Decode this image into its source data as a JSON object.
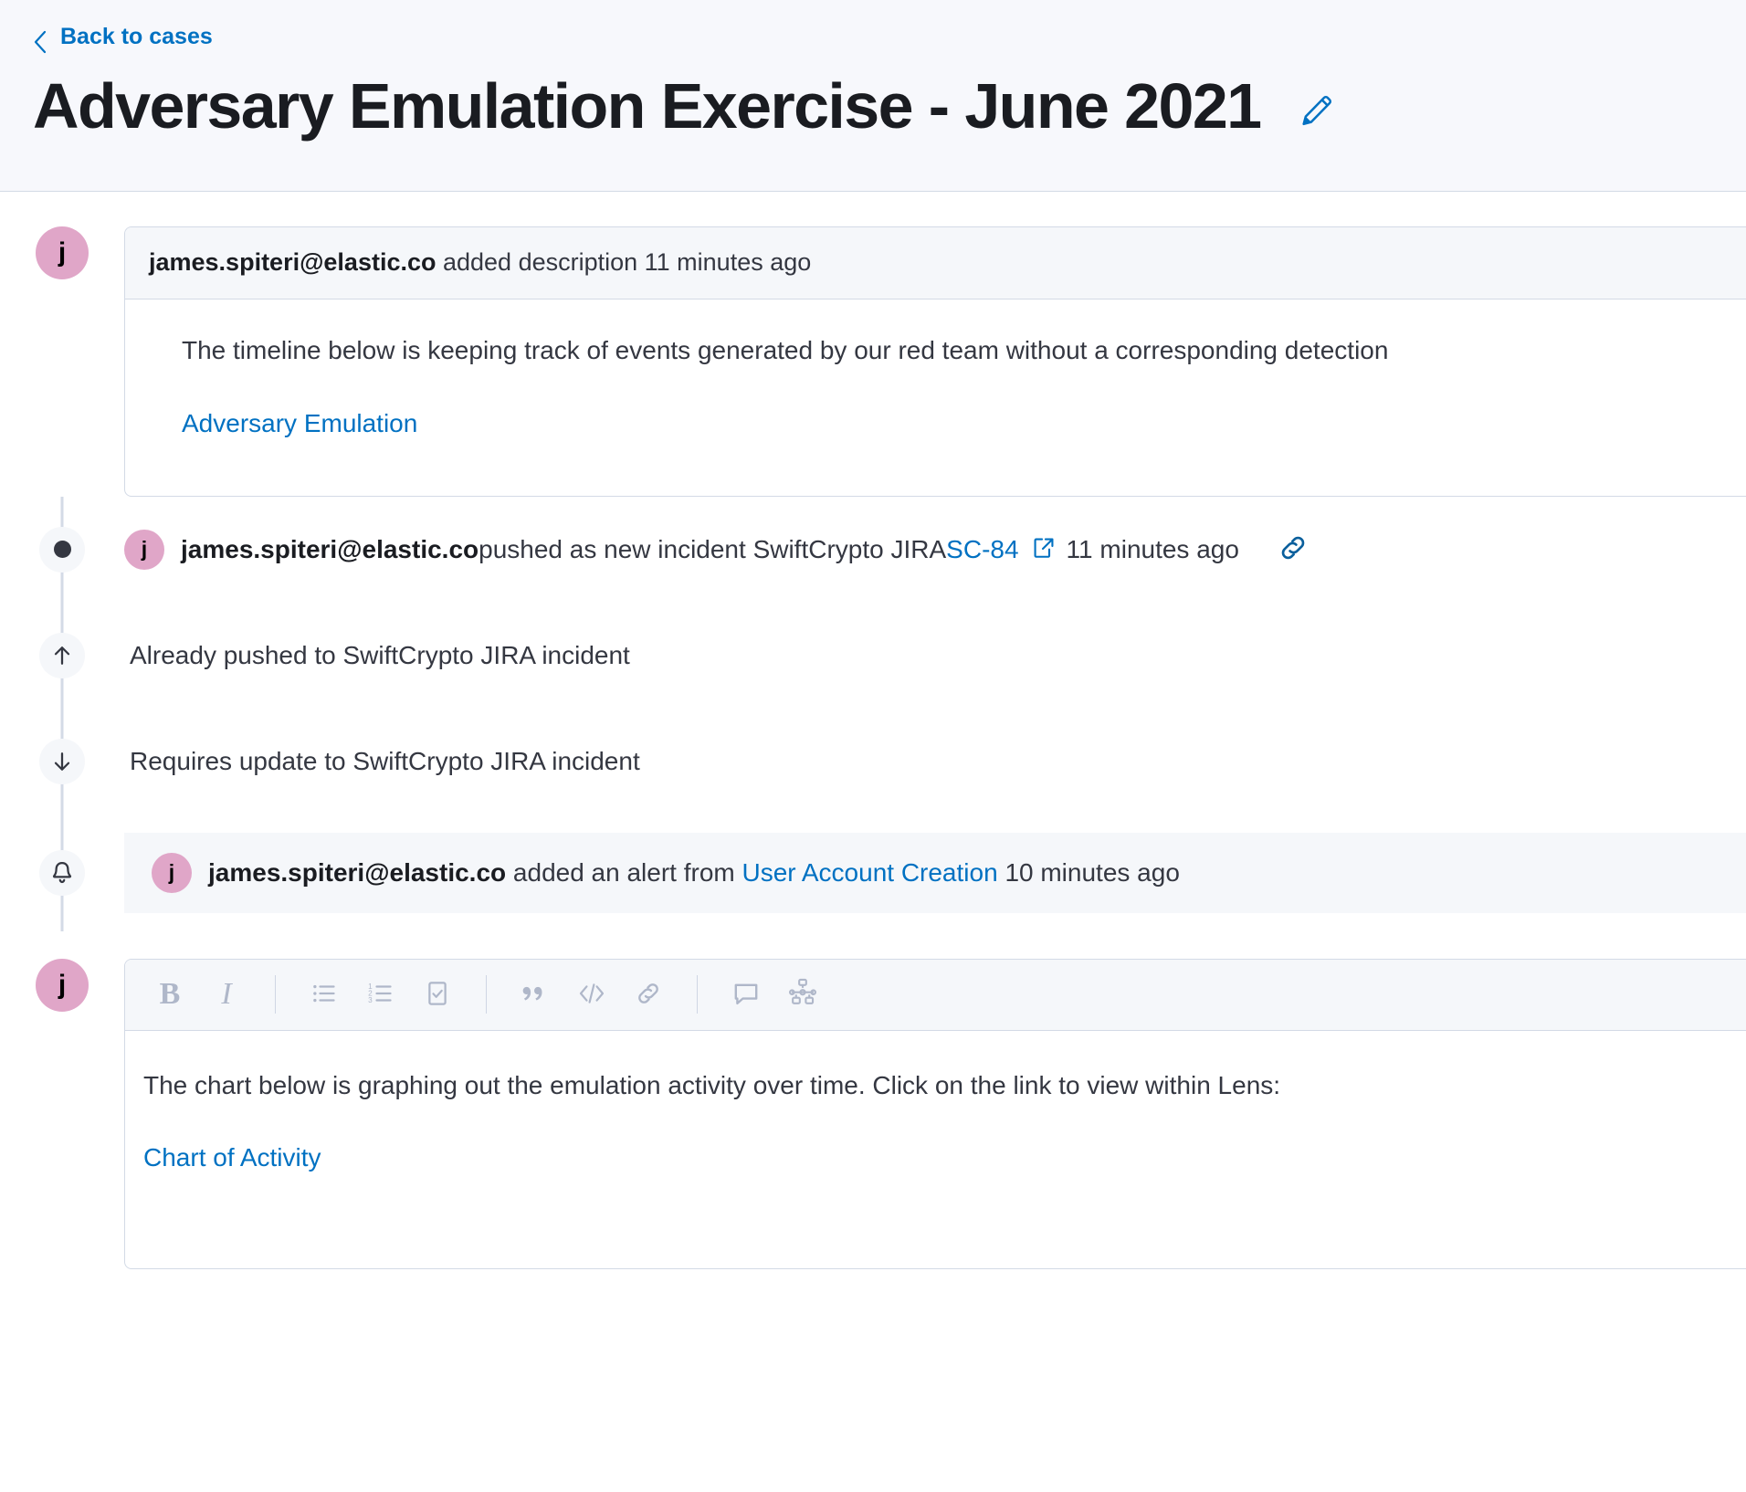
{
  "header": {
    "back_label": "Back to cases",
    "back_icon": "chevron-left-icon",
    "title": "Adversary Emulation Exercise - June 2021",
    "edit_icon": "pencil-edit-icon"
  },
  "colors": {
    "link": "#0071c2",
    "avatar_bg": "#e0a6c8",
    "panel_header_bg": "#f5f7fa",
    "border": "#d3dae6",
    "text": "#343741",
    "toolbar_icon": "#afb7c9"
  },
  "timeline": {
    "description_event": {
      "avatar_initial": "j",
      "user": "james.spiteri@elastic.co",
      "action": " added description ",
      "timestamp": "11 minutes ago",
      "body_text": "The timeline below is keeping track of events generated by our red team without a corresponding detection",
      "body_link": "Adversary Emulation"
    },
    "push_event": {
      "icon": "dot-icon",
      "avatar_initial": "j",
      "user": "james.spiteri@elastic.co",
      "action": " pushed as new incident SwiftCrypto JIRA ",
      "issue_link": "SC-84",
      "external_link_icon": "external-link-icon",
      "timestamp": "11 minutes ago",
      "copy_link_icon": "link-chain-icon"
    },
    "already_pushed_event": {
      "icon": "arrow-up-icon",
      "text": "Already pushed to SwiftCrypto JIRA incident"
    },
    "requires_update_event": {
      "icon": "arrow-down-icon",
      "text": "Requires update to SwiftCrypto JIRA incident"
    },
    "alert_event": {
      "icon": "bell-icon",
      "avatar_initial": "j",
      "user": "james.spiteri@elastic.co",
      "action": " added an alert from ",
      "rule_link": "User Account Creation",
      "timestamp": "10 minutes ago"
    },
    "comment_editor": {
      "avatar_initial": "j",
      "toolbar": [
        {
          "name": "bold-button",
          "label": "B",
          "kind": "text"
        },
        {
          "name": "italic-button",
          "label": "I",
          "kind": "text"
        },
        {
          "name": "separator-1",
          "kind": "sep"
        },
        {
          "name": "unordered-list-button",
          "kind": "icon",
          "icon": "bullet-list-icon"
        },
        {
          "name": "ordered-list-button",
          "kind": "icon",
          "icon": "numbered-list-icon"
        },
        {
          "name": "checklist-button",
          "kind": "icon",
          "icon": "checkbox-list-icon"
        },
        {
          "name": "separator-2",
          "kind": "sep"
        },
        {
          "name": "quote-button",
          "kind": "icon",
          "icon": "quote-icon"
        },
        {
          "name": "code-button",
          "kind": "icon",
          "icon": "code-icon"
        },
        {
          "name": "link-button",
          "kind": "icon",
          "icon": "link-chain-icon"
        },
        {
          "name": "separator-3",
          "kind": "sep"
        },
        {
          "name": "add-comment-button",
          "kind": "icon",
          "icon": "comment-bubble-icon"
        },
        {
          "name": "insert-timeline-button",
          "kind": "icon",
          "icon": "analyze-event-icon"
        }
      ],
      "text": "The chart below is graphing out the emulation activity over time. Click on the link to view within Lens:",
      "link": "Chart of Activity"
    }
  }
}
